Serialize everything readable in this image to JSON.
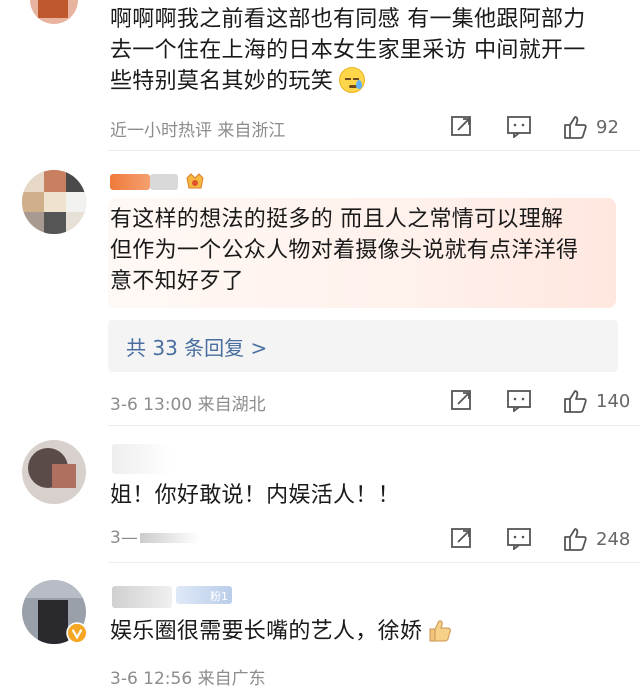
{
  "comments": [
    {
      "text_lines": [
        "啊啊啊我之前看这部也有同感 有一集他跟阿部力",
        "去一个住在上海的日本女生家里采访 中间就开一",
        "些特别莫名其妙的玩笑"
      ],
      "emoji_icon": "sweat-smile-emoji",
      "meta": "近一小时热评  来自浙江",
      "likes": "92"
    },
    {
      "text_lines": [
        "有这样的想法的挺多的 而且人之常情可以理解",
        "但作为一个公众人物对着摄像头说就有点洋洋得",
        "意不知好歹了"
      ],
      "reply_link": "共 33 条回复 >",
      "meta": "3-6 13:00  来自湖北",
      "likes": "140"
    },
    {
      "text_lines": [
        "姐！你好敢说！内娱活人！！"
      ],
      "meta": "3—",
      "likes": "248"
    },
    {
      "text_lines": [
        "娱乐圈很需要长嘴的艺人，徐娇"
      ],
      "emoji_icon": "thumbs-up-emoji",
      "fan_badge": "粉1",
      "meta": "3-6 12:56  来自广东"
    }
  ],
  "colors": {
    "meta": "#8c8c8c",
    "link": "#4a6ea0",
    "highlight": "#fff1ec"
  }
}
